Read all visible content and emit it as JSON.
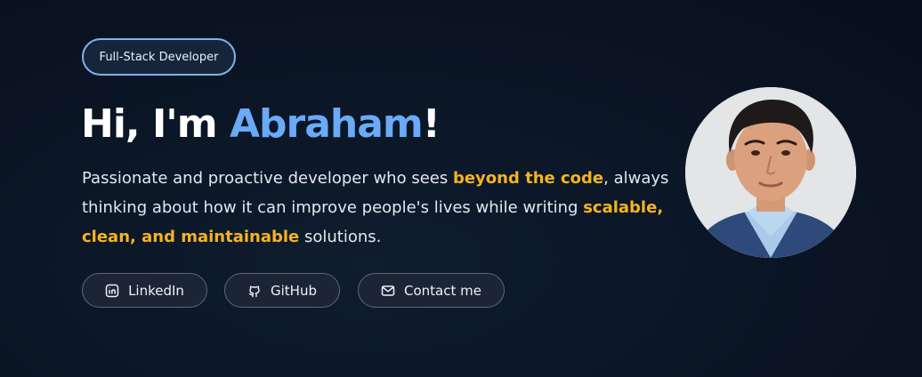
{
  "badge": {
    "label": "Full-Stack Developer"
  },
  "headline": {
    "greeting": "Hi, I'm ",
    "name": "Abraham",
    "suffix": "!"
  },
  "bio": {
    "part1": "Passionate and proactive developer who sees ",
    "highlight1": "beyond the code",
    "part2": ", always thinking about how it can improve people's lives while writing ",
    "highlight2": "scalable, clean, and maintainable",
    "part3": " solutions."
  },
  "buttons": {
    "linkedin": {
      "label": "LinkedIn",
      "icon": "linkedin-icon"
    },
    "github": {
      "label": "GitHub",
      "icon": "github-icon"
    },
    "contact": {
      "label": "Contact me",
      "icon": "mail-icon"
    }
  },
  "colors": {
    "accent_blue": "#6aaaf7",
    "highlight_orange": "#f6b322",
    "background": "#0b1626"
  }
}
